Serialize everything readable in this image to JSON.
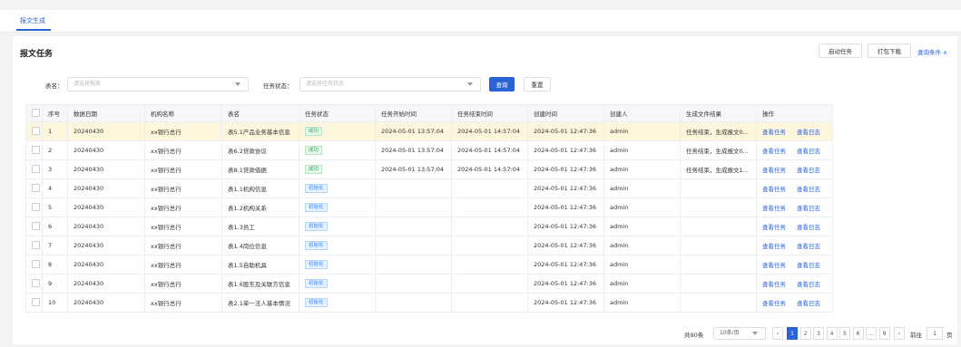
{
  "tabs": {
    "active": "报文生成"
  },
  "page_title": "报文任务",
  "toolbar": {
    "start_task": "启动任务",
    "pack_download": "打包下载",
    "query_conditions": "查询条件 ∧"
  },
  "filters": {
    "table_label": "表名：",
    "table_placeholder": "请选择报表",
    "status_label": "任务状态：",
    "status_placeholder": "请选择任务状态",
    "query_button": "查询",
    "reset_button": "重置"
  },
  "table": {
    "headers": [
      "",
      "序号",
      "数据日期",
      "机构名称",
      "表名",
      "任务状态",
      "任务开始时间",
      "任务结束时间",
      "创建时间",
      "创建人",
      "生成文件结果",
      "操作"
    ],
    "rows": [
      {
        "no": "1",
        "date": "20240430",
        "org": "xx银行总行",
        "name": "表5.1产品业务基本信息",
        "status": "成功",
        "status_type": "ok",
        "start": "2024-05-01 13:57:04",
        "end": "2024-05-01 14:57:04",
        "created": "2024-05-01 12:47:36",
        "creator": "admin",
        "result": "任务结束，生成报文0...",
        "action1": "查看任务",
        "action2": "查看日志"
      },
      {
        "no": "2",
        "date": "20240430",
        "org": "xx银行总行",
        "name": "表6.2贷款协议",
        "status": "成功",
        "status_type": "ok",
        "start": "2024-05-01 13:57:04",
        "end": "2024-05-01 14:57:04",
        "created": "2024-05-01 12:47:36",
        "creator": "admin",
        "result": "任务结束，生成报文0...",
        "action1": "查看任务",
        "action2": "查看日志"
      },
      {
        "no": "3",
        "date": "20240430",
        "org": "xx银行总行",
        "name": "表8.1贷款借据",
        "status": "成功",
        "status_type": "ok",
        "start": "2024-05-01 13:57:04",
        "end": "2024-05-01 14:57:04",
        "created": "2024-05-01 12:47:36",
        "creator": "admin",
        "result": "任务结束，生成报文1...",
        "action1": "查看任务",
        "action2": "查看日志"
      },
      {
        "no": "4",
        "date": "20240430",
        "org": "xx银行总行",
        "name": "表1.1机构信息",
        "status": "初始化",
        "status_type": "init",
        "start": "",
        "end": "",
        "created": "2024-05-01 12:47:36",
        "creator": "admin",
        "result": "",
        "action1": "查看任务",
        "action2": "查看日志"
      },
      {
        "no": "5",
        "date": "20240430",
        "org": "xx银行总行",
        "name": "表1.2机构关系",
        "status": "初始化",
        "status_type": "init",
        "start": "",
        "end": "",
        "created": "2024-05-01 12:47:36",
        "creator": "admin",
        "result": "",
        "action1": "查看任务",
        "action2": "查看日志"
      },
      {
        "no": "6",
        "date": "20240430",
        "org": "xx银行总行",
        "name": "表1.3员工",
        "status": "初始化",
        "status_type": "init",
        "start": "",
        "end": "",
        "created": "2024-05-01 12:47:36",
        "creator": "admin",
        "result": "",
        "action1": "查看任务",
        "action2": "查看日志"
      },
      {
        "no": "7",
        "date": "20240430",
        "org": "xx银行总行",
        "name": "表1.4岗位信息",
        "status": "初始化",
        "status_type": "init",
        "start": "",
        "end": "",
        "created": "2024-05-01 12:47:36",
        "creator": "admin",
        "result": "",
        "action1": "查看任务",
        "action2": "查看日志"
      },
      {
        "no": "8",
        "date": "20240430",
        "org": "xx银行总行",
        "name": "表1.5自助机具",
        "status": "初始化",
        "status_type": "init",
        "start": "",
        "end": "",
        "created": "2024-05-01 12:47:36",
        "creator": "admin",
        "result": "",
        "action1": "查看任务",
        "action2": "查看日志"
      },
      {
        "no": "9",
        "date": "20240430",
        "org": "xx银行总行",
        "name": "表1.6股东及关联方信息",
        "status": "初始化",
        "status_type": "init",
        "start": "",
        "end": "",
        "created": "2024-05-01 12:47:36",
        "creator": "admin",
        "result": "",
        "action1": "查看任务",
        "action2": "查看日志"
      },
      {
        "no": "10",
        "date": "20240430",
        "org": "xx银行总行",
        "name": "表2.1单一法人基本情况",
        "status": "初始化",
        "status_type": "init",
        "start": "",
        "end": "",
        "created": "2024-05-01 12:47:36",
        "creator": "admin",
        "result": "",
        "action1": "查看任务",
        "action2": "查看日志"
      }
    ]
  },
  "pagination": {
    "total": "共90条",
    "page_size": "10条/页",
    "pages": [
      "1",
      "2",
      "3",
      "4",
      "5",
      "6",
      "...",
      "9"
    ],
    "current": "1",
    "goto_label": "前往",
    "goto_value": "1",
    "page_unit": "页"
  },
  "colors": {
    "accent": "#2a63d9",
    "highlight_row": "#fdf6dc",
    "success": "#3aa35b",
    "init": "#3b86e8"
  }
}
